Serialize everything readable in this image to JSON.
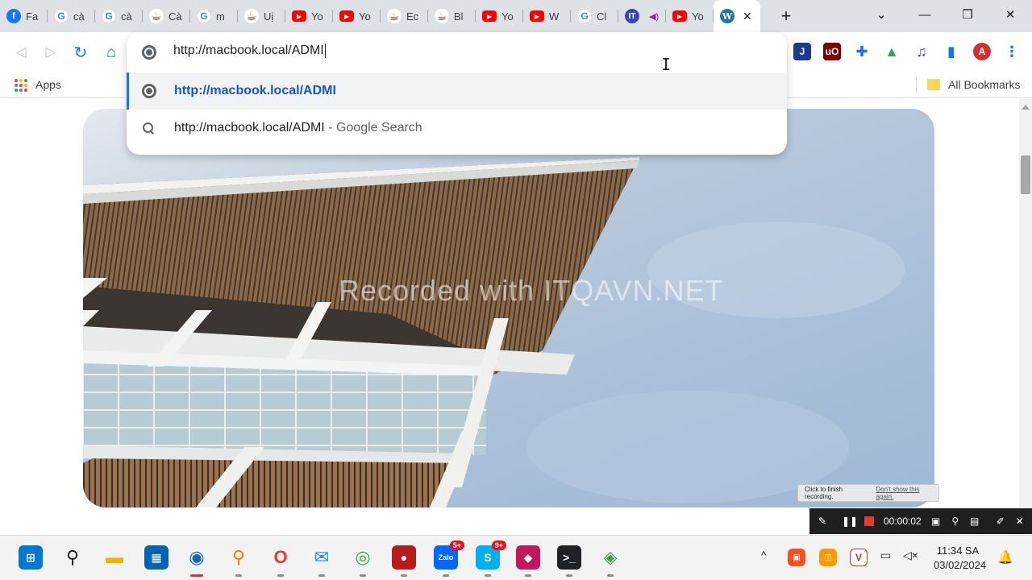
{
  "tabs": [
    {
      "title": "Fa",
      "icon": "facebook-icon",
      "glyph": "f"
    },
    {
      "title": "cà",
      "icon": "google-icon",
      "glyph": "G"
    },
    {
      "title": "cà",
      "icon": "google-icon",
      "glyph": "G"
    },
    {
      "title": "Cà",
      "icon": "coffee-cup-icon",
      "glyph": "☕"
    },
    {
      "title": "m",
      "icon": "google-icon",
      "glyph": "G"
    },
    {
      "title": "Uị",
      "icon": "coffee-cup-icon",
      "glyph": "☕"
    },
    {
      "title": "Yo",
      "icon": "youtube-icon",
      "glyph": "▶"
    },
    {
      "title": "Yo",
      "icon": "youtube-icon",
      "glyph": "▶"
    },
    {
      "title": "Ec",
      "icon": "coffee-cup-icon",
      "glyph": "☕"
    },
    {
      "title": "Bl",
      "icon": "coffee-cup-icon",
      "glyph": "☕"
    },
    {
      "title": "Yo",
      "icon": "youtube-icon",
      "glyph": "▶"
    },
    {
      "title": "W",
      "icon": "youtube-icon",
      "glyph": "▶"
    },
    {
      "title": "Cl",
      "icon": "google-icon",
      "glyph": "G"
    },
    {
      "title": "",
      "icon": "it-icon",
      "glyph": "IT",
      "audio": "◀)"
    },
    {
      "title": "Yo",
      "icon": "youtube-icon",
      "glyph": "▶"
    }
  ],
  "active_tab": {
    "icon": "wordpress-icon",
    "glyph": "W",
    "close": "✕"
  },
  "new_tab": "+",
  "window": {
    "dropdown": "⌄",
    "minimize": "—",
    "restore": "❐",
    "close": "✕"
  },
  "toolbar": {
    "back": "◁",
    "forward": "▷",
    "reload": "↻",
    "home": "⌂"
  },
  "extensions": [
    {
      "name": "shield-extension-icon",
      "glyph": "J",
      "color": "#1e3a8a"
    },
    {
      "name": "ublock-icon",
      "glyph": "uO",
      "color": "#800000"
    },
    {
      "name": "puzzle-icon",
      "glyph": "✚",
      "color": "#1a73e8"
    },
    {
      "name": "flask-icon",
      "glyph": "▲",
      "color": "#34a853"
    },
    {
      "name": "media-icon",
      "glyph": "♫",
      "color": "#673ab7"
    },
    {
      "name": "sidepanel-icon",
      "glyph": "▮",
      "color": "#1a73e8"
    },
    {
      "name": "athena-avatar-icon",
      "glyph": "A",
      "color": "#d32f2f"
    },
    {
      "name": "menu-icon",
      "glyph": "⋮",
      "color": "#1a73e8"
    }
  ],
  "bookmarks": {
    "apps_label": "Apps",
    "all_label": "All Bookmarks"
  },
  "omnibox": {
    "value": "http://macbook.local/ADMI",
    "suggestions": [
      {
        "text": "http://macbook.local/ADMI",
        "suffix": "",
        "icon": "globe-icon",
        "selected": true
      },
      {
        "text": "http://macbook.local/ADMI",
        "suffix": " - Google Search",
        "icon": "search-icon",
        "selected": false
      }
    ]
  },
  "watermark": "Recorded with ITQAVN.NET",
  "recorder": {
    "tip_text": "Click to finish recording.",
    "tip_link": "Don't show this again.",
    "time": "00:00:02"
  },
  "taskbar": {
    "apps": [
      {
        "name": "start-icon",
        "glyph": "⊞",
        "color": "#0078d4"
      },
      {
        "name": "search-icon",
        "glyph": "⚲",
        "color": "#202124"
      },
      {
        "name": "file-explorer-icon",
        "glyph": "▬",
        "color": "#f0b400"
      },
      {
        "name": "store-icon",
        "glyph": "▦",
        "color": "#0063b1"
      },
      {
        "name": "chrome-canary-icon",
        "glyph": "◉",
        "color": "#1565c0"
      },
      {
        "name": "magnifier-app-icon",
        "glyph": "⚲",
        "color": "#f57c00"
      },
      {
        "name": "opera-icon",
        "glyph": "O",
        "color": "#e53935"
      },
      {
        "name": "thunderbird-icon",
        "glyph": "✉",
        "color": "#1e88e5"
      },
      {
        "name": "chrome-icon",
        "glyph": "◎",
        "color": "#34a853"
      },
      {
        "name": "screen-recorder-icon",
        "glyph": "●",
        "color": "#b71c1c"
      },
      {
        "name": "zalo-icon",
        "glyph": "Zalo",
        "color": "#0068ff",
        "badge": "5+"
      },
      {
        "name": "skype-icon",
        "glyph": "S",
        "color": "#00aff0",
        "badge": "9+"
      },
      {
        "name": "app-pink-icon",
        "glyph": "◆",
        "color": "#c2185b"
      },
      {
        "name": "terminal-icon",
        "glyph": ">_",
        "color": "#202124"
      },
      {
        "name": "app-green-icon",
        "glyph": "◈",
        "color": "#43a047"
      }
    ],
    "tray": {
      "chevron": "^",
      "speaker": "🔇"
    },
    "time": "11:34 SA",
    "date": "03/02/2024"
  }
}
